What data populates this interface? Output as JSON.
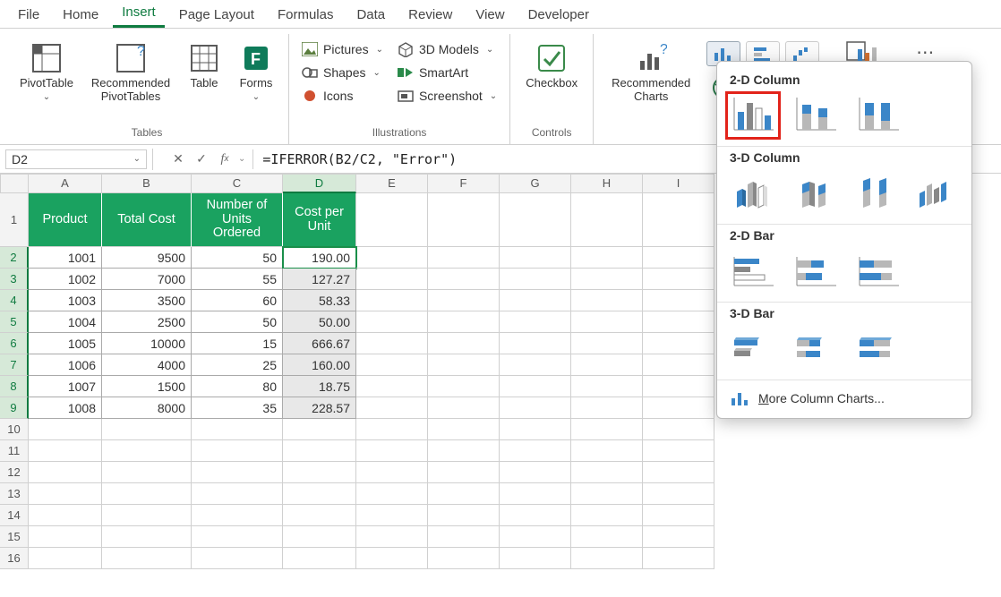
{
  "tabs": [
    "File",
    "Home",
    "Insert",
    "Page Layout",
    "Formulas",
    "Data",
    "Review",
    "View",
    "Developer"
  ],
  "active_tab": "Insert",
  "ribbon": {
    "tables_group": {
      "label": "Tables",
      "items": [
        "PivotTable",
        "Recommended PivotTables",
        "Table",
        "Forms"
      ]
    },
    "illustrations_group": {
      "label": "Illustrations",
      "items": [
        "Pictures",
        "Shapes",
        "Icons",
        "3D Models",
        "SmartArt",
        "Screenshot"
      ]
    },
    "controls_group": {
      "label": "Controls",
      "checkbox": "Checkbox"
    },
    "charts_group": {
      "recommended": "Recommended Charts"
    }
  },
  "formula_bar": {
    "name_box": "D2",
    "formula": "=IFERROR(B2/C2, \"Error\")"
  },
  "columns": [
    "A",
    "B",
    "C",
    "D",
    "E",
    "F",
    "G",
    "H",
    "I"
  ],
  "selected_col": "D",
  "selected_rows": [
    2,
    3,
    4,
    5,
    6,
    7,
    8,
    9
  ],
  "active_cell": "D2",
  "headers": [
    "Product",
    "Total Cost",
    "Number of Units Ordered",
    "Cost per Unit"
  ],
  "rows": [
    {
      "n": 1
    },
    {
      "n": 2,
      "A": "1001",
      "B": "9500",
      "C": "50",
      "D": "190.00"
    },
    {
      "n": 3,
      "A": "1002",
      "B": "7000",
      "C": "55",
      "D": "127.27"
    },
    {
      "n": 4,
      "A": "1003",
      "B": "3500",
      "C": "60",
      "D": "58.33"
    },
    {
      "n": 5,
      "A": "1004",
      "B": "2500",
      "C": "50",
      "D": "50.00"
    },
    {
      "n": 6,
      "A": "1005",
      "B": "10000",
      "C": "15",
      "D": "666.67"
    },
    {
      "n": 7,
      "A": "1006",
      "B": "4000",
      "C": "25",
      "D": "160.00"
    },
    {
      "n": 8,
      "A": "1007",
      "B": "1500",
      "C": "80",
      "D": "18.75"
    },
    {
      "n": 9,
      "A": "1008",
      "B": "8000",
      "C": "35",
      "D": "228.57"
    },
    {
      "n": 10
    },
    {
      "n": 11
    },
    {
      "n": 12
    },
    {
      "n": 13
    },
    {
      "n": 14
    },
    {
      "n": 15
    },
    {
      "n": 16
    }
  ],
  "chart_panel": {
    "sections": [
      "2-D Column",
      "3-D Column",
      "2-D Bar",
      "3-D Bar"
    ],
    "more": "More Column Charts..."
  },
  "colors": {
    "accent": "#1aa260",
    "highlight": "#e2231a",
    "chart_blue": "#3b86c8",
    "chart_grey": "#b8b8b8"
  }
}
